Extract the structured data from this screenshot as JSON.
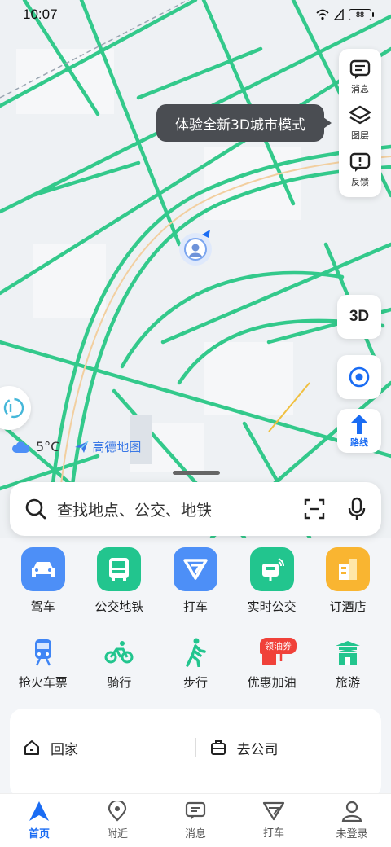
{
  "status_bar": {
    "time": "10:07",
    "battery": "88"
  },
  "map": {
    "tooltip": "体验全新3D城市模式",
    "tools": [
      {
        "label": "消息",
        "icon": "message-icon"
      },
      {
        "label": "图层",
        "icon": "layers-icon"
      },
      {
        "label": "反馈",
        "icon": "feedback-icon"
      }
    ],
    "mode_3d": "3D",
    "route_label": "路线",
    "weather_temp": "5°C",
    "brand": "高德地图"
  },
  "search": {
    "placeholder": "查找地点、公交、地铁"
  },
  "quick_row1": [
    {
      "label": "驾车",
      "icon": "car-icon",
      "color": "#4d8ff7"
    },
    {
      "label": "公交地铁",
      "icon": "bus-icon",
      "color": "#22c58e"
    },
    {
      "label": "打车",
      "icon": "taxi-icon",
      "color": "#4d8ff7"
    },
    {
      "label": "实时公交",
      "icon": "bus-stop-icon",
      "color": "#22c58e"
    },
    {
      "label": "订酒店",
      "icon": "hotel-icon",
      "color": "#f9b531"
    }
  ],
  "quick_row2": [
    {
      "label": "抢火车票",
      "icon": "train-icon"
    },
    {
      "label": "骑行",
      "icon": "bike-icon"
    },
    {
      "label": "步行",
      "icon": "walk-icon"
    },
    {
      "label": "优惠加油",
      "icon": "fuel-icon"
    },
    {
      "label": "旅游",
      "icon": "travel-icon"
    }
  ],
  "coupon_badge": "领油券",
  "shortcuts": {
    "home": "回家",
    "company": "去公司"
  },
  "bottom_nav": [
    {
      "label": "首页",
      "icon": "home-nav-icon",
      "active": true
    },
    {
      "label": "附近",
      "icon": "nearby-icon"
    },
    {
      "label": "消息",
      "icon": "message-nav-icon"
    },
    {
      "label": "打车",
      "icon": "taxi-nav-icon"
    },
    {
      "label": "未登录",
      "icon": "user-icon"
    }
  ],
  "colors": {
    "road": "#33c98b",
    "accent": "#1a6cf3",
    "map_bg": "#eef1f4"
  }
}
